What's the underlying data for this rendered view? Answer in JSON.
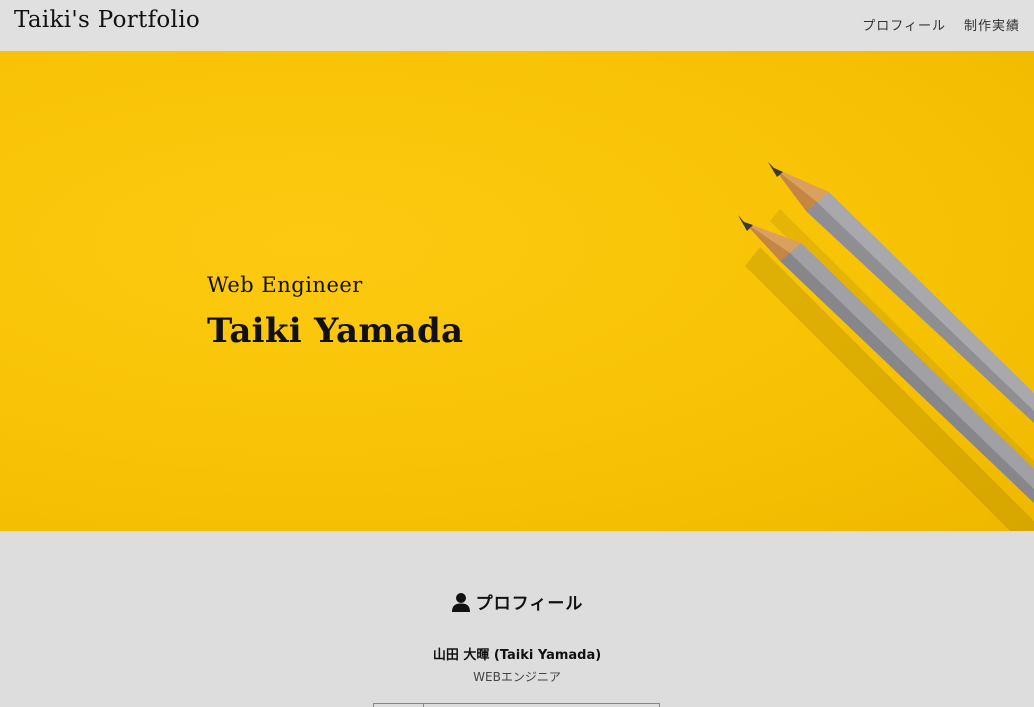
{
  "header": {
    "site_title": "Taiki's Portfolio",
    "nav": [
      {
        "label": "プロフィール"
      },
      {
        "label": "制作実績"
      }
    ]
  },
  "hero": {
    "role": "Web Engineer",
    "name": "Taiki Yamada",
    "background_color": "#f8c304"
  },
  "profile": {
    "heading": "プロフィール",
    "heading_icon": "user-icon",
    "name": "山田 大暉 (Taiki Yamada)",
    "role": "WEBエンジニア"
  }
}
